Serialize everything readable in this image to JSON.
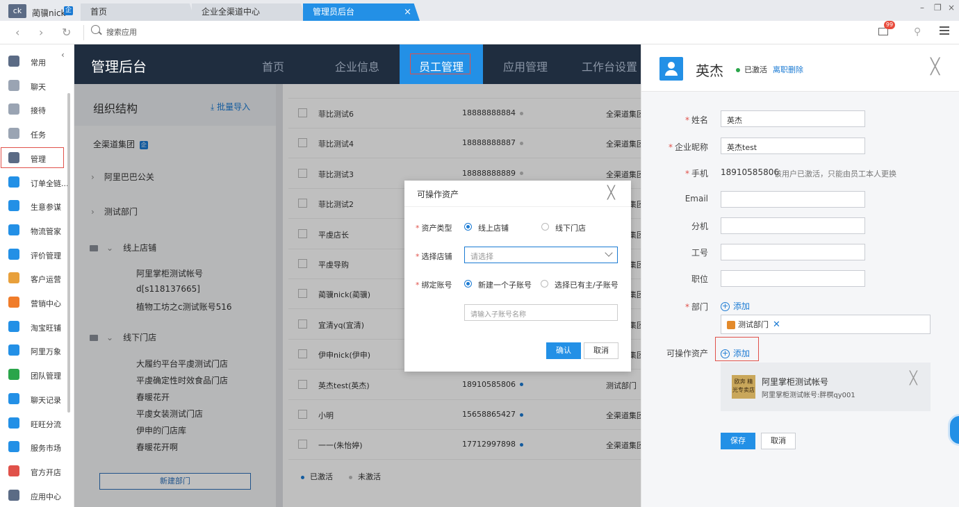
{
  "topbar": {
    "avatar_text": "ck",
    "user_name": "蔺骥nick",
    "user_badge": "企",
    "tabs": [
      {
        "label": "首页"
      },
      {
        "label": "企业全渠道中心"
      },
      {
        "label": "管理员后台"
      }
    ],
    "tab_close": "×",
    "window_controls": [
      "–",
      "❐",
      "×"
    ]
  },
  "navbar": {
    "back": "‹",
    "forward": "›",
    "refresh": "↻",
    "search_placeholder": "搜索应用",
    "mail_badge": "99",
    "pin": "⚲"
  },
  "sidebar": {
    "collapse": "‹",
    "items": [
      {
        "label": "常用",
        "icon": "list-icon",
        "color": "#5b6b85"
      },
      {
        "label": "聊天",
        "icon": "chat-icon",
        "color": "#9aa4b3"
      },
      {
        "label": "接待",
        "icon": "reception-icon",
        "color": "#9aa4b3"
      },
      {
        "label": "任务",
        "icon": "task-icon",
        "color": "#9aa4b3"
      },
      {
        "label": "管理",
        "icon": "admin-icon",
        "color": "#5b6b85"
      },
      {
        "label": "订单全链...",
        "icon": "order-icon",
        "color": "#2390e6"
      },
      {
        "label": "生意参谋",
        "icon": "business-icon",
        "color": "#2390e6"
      },
      {
        "label": "物流管家",
        "icon": "logistics-icon",
        "color": "#2390e6"
      },
      {
        "label": "评价管理",
        "icon": "review-icon",
        "color": "#2390e6"
      },
      {
        "label": "客户运营",
        "icon": "customer-icon",
        "color": "#e8a03b"
      },
      {
        "label": "营销中心",
        "icon": "marketing-icon",
        "color": "#f07c2a"
      },
      {
        "label": "淘宝旺铺",
        "icon": "shop-icon",
        "color": "#2390e6"
      },
      {
        "label": "阿里万象",
        "icon": "wanxiang-icon",
        "color": "#2390e6"
      },
      {
        "label": "团队管理",
        "icon": "team-icon",
        "color": "#2aa54a"
      },
      {
        "label": "聊天记录",
        "icon": "chat-log-icon",
        "color": "#2390e6"
      },
      {
        "label": "旺旺分流",
        "icon": "split-icon",
        "color": "#2390e6"
      },
      {
        "label": "服务市场",
        "icon": "market-icon",
        "color": "#2390e6"
      },
      {
        "label": "官方开店",
        "icon": "open-store-icon",
        "color": "#e0514a"
      },
      {
        "label": "应用中心",
        "icon": "app-center-icon",
        "color": "#5b6b85"
      }
    ]
  },
  "admin": {
    "title": "管理后台",
    "nav": [
      {
        "label": "首页"
      },
      {
        "label": "企业信息"
      },
      {
        "label": "员工管理"
      },
      {
        "label": "应用管理"
      },
      {
        "label": "工作台设置"
      }
    ]
  },
  "org": {
    "title": "组织结构",
    "import": "批量导入",
    "root": "全渠道集团",
    "root_badge": "企",
    "depts": [
      "阿里巴巴公关",
      "测试部门"
    ],
    "online_title": "线上店铺",
    "online_stores": [
      "阿里掌柜测试帐号",
      "d[s118137665]",
      "植物工坊之c测试账号516"
    ],
    "offline_title": "线下门店",
    "offline_stores": [
      "大履约平台平虔测试门店",
      "平虔确定性时效食品门店",
      "春暖花开",
      "平虔女装测试门店",
      "伊申的门店库",
      "春暖花开啊"
    ],
    "new_dept": "新建部门"
  },
  "employees": [
    {
      "name": "菲比测试6",
      "phone": "18888888884",
      "active": false,
      "dept": "全渠道集团"
    },
    {
      "name": "菲比测试4",
      "phone": "18888888887",
      "active": false,
      "dept": "全渠道集团"
    },
    {
      "name": "菲比测试3",
      "phone": "18888888889",
      "active": false,
      "dept": "全渠道集团"
    },
    {
      "name": "菲比测试2",
      "phone": "",
      "active": false,
      "dept": "全渠道集团"
    },
    {
      "name": "平虔店长",
      "phone": "",
      "active": false,
      "dept": "全渠道集团"
    },
    {
      "name": "平虔导购",
      "phone": "",
      "active": false,
      "dept": "全渠道集团"
    },
    {
      "name": "蔺骥nick(蔺骥)",
      "phone": "",
      "active": false,
      "dept": "全渠道集团"
    },
    {
      "name": "宜清yq(宜清)",
      "phone": "",
      "active": false,
      "dept": "全渠道集团"
    },
    {
      "name": "伊申nick(伊申)",
      "phone": "",
      "active": false,
      "dept": "全渠道集团"
    },
    {
      "name": "英杰test(英杰)",
      "phone": "18910585806",
      "active": true,
      "dept": "测试部门"
    },
    {
      "name": "小明",
      "phone": "15658865427",
      "active": true,
      "dept": "全渠道集团"
    },
    {
      "name": "一一(朱怡婷)",
      "phone": "17712997898",
      "active": true,
      "dept": "全渠道集团"
    }
  ],
  "legend": {
    "active": "已激活",
    "inactive": "未激活",
    "active_color": "#1a7ad3",
    "inactive_color": "#bbbbbb"
  },
  "modal": {
    "title": "可操作资产",
    "close": "╳",
    "asset_type_label": "资产类型",
    "asset_online": "线上店铺",
    "asset_offline": "线下门店",
    "select_store_label": "选择店铺",
    "select_placeholder": "请选择",
    "bind_label": "绑定账号",
    "bind_new": "新建一个子账号",
    "bind_existing": "选择已有主/子账号",
    "sub_placeholder": "请输入子账号名称",
    "ok": "确认",
    "cancel": "取消",
    "required": "*"
  },
  "detail": {
    "name": "英杰",
    "status": "已激活",
    "resign": "离职删除",
    "close": "╳",
    "required": "*",
    "fields": {
      "name_label": "姓名",
      "name_value": "英杰",
      "nick_label": "企业昵称",
      "nick_value": "英杰test",
      "phone_label": "手机",
      "phone_value": "18910585806",
      "phone_note": "该用户已激活，只能由员工本人更换",
      "email_label": "Email",
      "ext_label": "分机",
      "job_no_label": "工号",
      "position_label": "职位",
      "dept_label": "部门",
      "dept_add": "添加",
      "dept_tag": "测试部门",
      "dept_tag_x": "✕",
      "asset_label": "可操作资产",
      "asset_add": "添加"
    },
    "asset": {
      "logo_text": "欧奔 精光专卖店",
      "title": "阿里掌柜测试帐号",
      "sub": "阿里掌柜测试帐号:胖榠qy001",
      "close": "╳"
    },
    "save": "保存",
    "cancel": "取消"
  }
}
